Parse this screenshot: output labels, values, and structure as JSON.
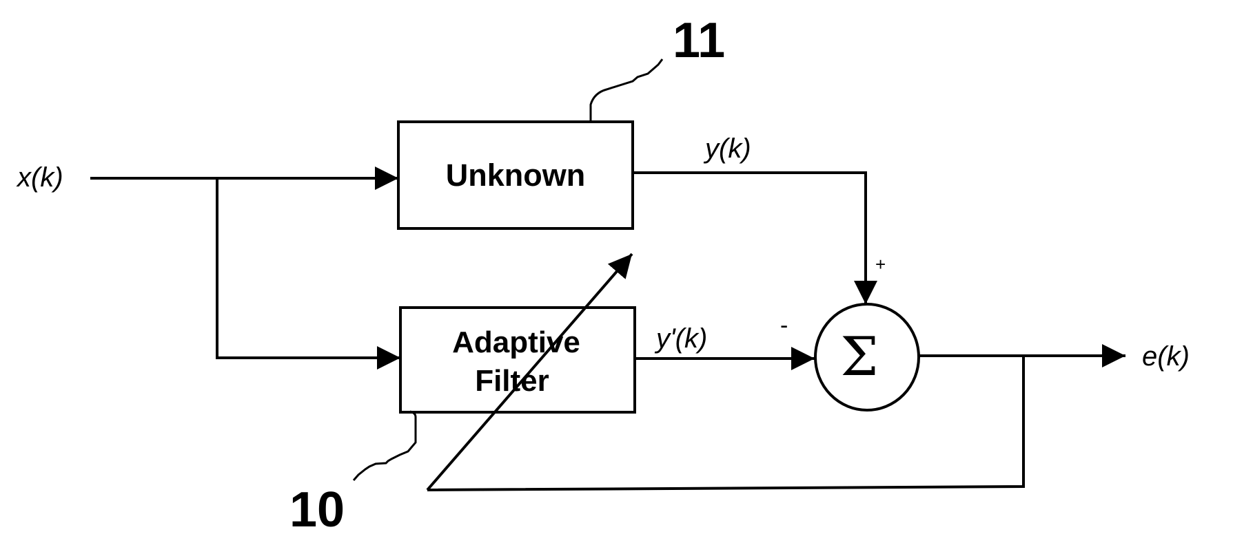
{
  "diagram": {
    "type": "adaptive-filter system identification block diagram",
    "signals": {
      "input": "x(k)",
      "unknown_output": "y(k)",
      "filter_output": "y'(k)",
      "error_output": "e(k)"
    },
    "blocks": {
      "unknown": {
        "label": "Unknown",
        "reference": "11"
      },
      "adaptive_filter": {
        "line1": "Adaptive",
        "line2": "Filter",
        "reference": "10"
      }
    },
    "summing_junction": {
      "symbol": "Σ",
      "plus_sign": "+",
      "minus_sign": "-"
    },
    "colors": {
      "ink": "#000000",
      "background": "#ffffff"
    }
  }
}
